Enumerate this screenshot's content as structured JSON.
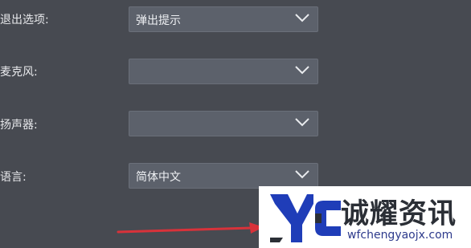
{
  "settings": {
    "rows": [
      {
        "label": "退出选项:",
        "value": "弹出提示"
      },
      {
        "label": "麦克风:",
        "value": ""
      },
      {
        "label": "扬声器:",
        "value": ""
      },
      {
        "label": "语言:",
        "value": "简体中文"
      }
    ]
  },
  "watermark": {
    "title": "诚耀资讯",
    "url": "wfchengyaojx.com",
    "colors": {
      "mark_blue": "#1f3db8",
      "mark_dark": "#2b2f36",
      "title": "#2b2f36",
      "url": "#2d3a8c"
    }
  },
  "colors": {
    "background": "#474a51",
    "select_bg": "#5c616b",
    "text": "#e8e9ec",
    "arrow": "#d8323a"
  },
  "icons": {
    "dropdown": "chevron-down-icon",
    "annotation": "red-arrow-icon",
    "logo": "yc-logo-icon"
  }
}
